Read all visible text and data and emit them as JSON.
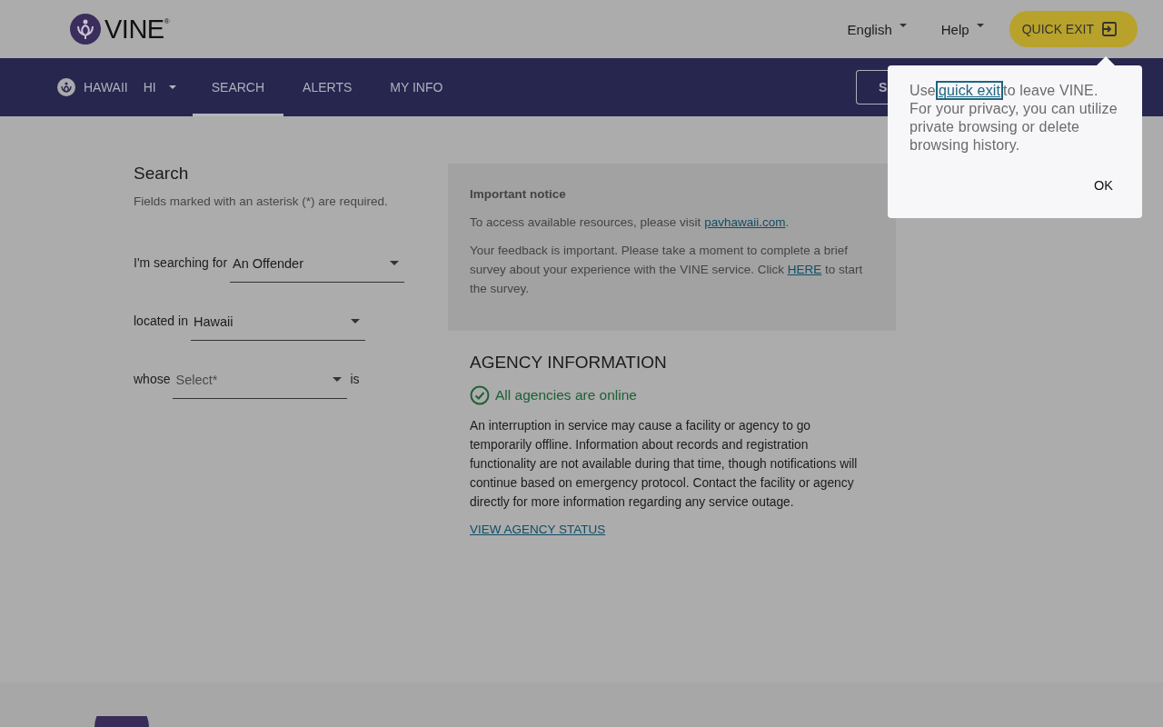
{
  "header": {
    "brand": "VINE",
    "trademark": "®",
    "menus": [
      {
        "label": "English"
      },
      {
        "label": "Help"
      }
    ],
    "quick_exit": "QUICK EXIT"
  },
  "nav": {
    "state_name": "HAWAII",
    "state_code": "HI",
    "tabs": [
      {
        "label": "SEARCH",
        "selected": true
      },
      {
        "label": "ALERTS",
        "selected": false
      },
      {
        "label": "MY INFO",
        "selected": false
      }
    ],
    "partial_button": "S"
  },
  "search": {
    "title": "Search",
    "hint": "Fields marked with an asterisk (*) are required.",
    "fields": [
      {
        "label": "I'm searching for",
        "value": "An Offender"
      },
      {
        "label": "located in",
        "value": "Hawaii"
      },
      {
        "label": "whose",
        "placeholder": "Select*",
        "suffix": "is"
      }
    ]
  },
  "notice": {
    "title": "Important notice",
    "line1": "To access available resources, please visit",
    "link": "pavhawaii.com",
    "line1_end": ".",
    "line2": "Your feedback is important. Please take a moment to complete a brief survey about your experience with the VINE service. Click",
    "link2": "HERE",
    "line2_end": "to start the survey."
  },
  "agency": {
    "title": "AGENCY INFORMATION",
    "status": "All agencies are online",
    "body": "An interruption in service may cause a facility or agency to go temporarily offline. Information about records and registration functionality are not available during that time, though notifications will continue based on emergency protocol. Contact the facility or agency directly for more information regarding any service outage.",
    "link": "VIEW AGENCY STATUS"
  },
  "popover": {
    "before": "Use",
    "link": "quick exit",
    "after": "to leave VINE. For your privacy, you can utilize private browsing or delete browsing history.",
    "button": "OK"
  }
}
